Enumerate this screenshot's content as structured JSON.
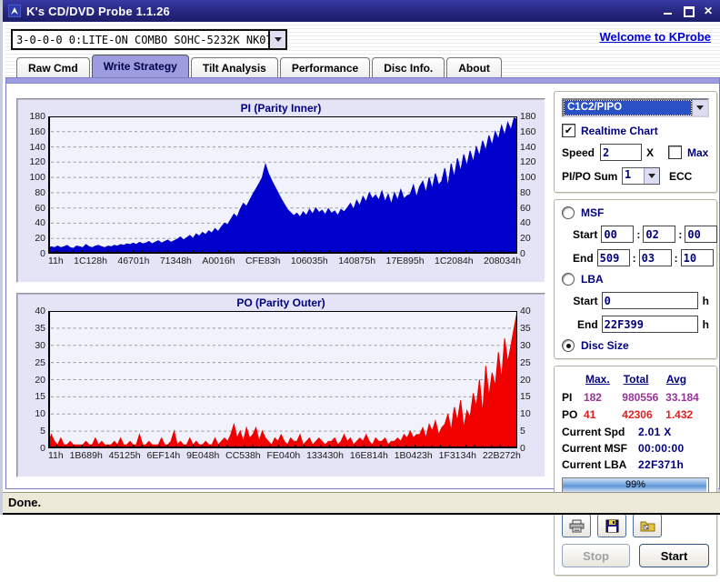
{
  "window": {
    "title": "K's CD/DVD Probe 1.1.26",
    "status": "Done."
  },
  "toolbar": {
    "device": "3-0-0-0 0:LITE-ON COMBO SOHC-5232K NK07",
    "welcome_link": "Welcome to KProbe"
  },
  "tabs": [
    {
      "label": "Raw Cmd",
      "active": false
    },
    {
      "label": "Write Strategy",
      "active": true
    },
    {
      "label": "Tilt Analysis",
      "active": false
    },
    {
      "label": "Performance",
      "active": false
    },
    {
      "label": "Disc Info.",
      "active": false
    },
    {
      "label": "About",
      "active": false
    }
  ],
  "controls": {
    "mode_select": "C1C2/PIPO",
    "realtime_chart": "Realtime Chart",
    "speed_label": "Speed",
    "speed_value": "2",
    "speed_unit": "X",
    "max_label": "Max",
    "pipo_sum_label": "PI/PO Sum",
    "pipo_sum_value": "1",
    "ecc_label": "ECC",
    "msf_label": "MSF",
    "start_label": "Start",
    "end_label": "End",
    "colon": ":",
    "msf_start": [
      "00",
      "02",
      "00"
    ],
    "msf_end": [
      "509",
      "03",
      "10"
    ],
    "lba_label": "LBA",
    "lba_start": "0",
    "lba_end": "22F399",
    "hex_unit": "h",
    "disc_size_label": "Disc Size"
  },
  "stats": {
    "headers": [
      "Max.",
      "Total",
      "Avg"
    ],
    "rows": [
      {
        "label": "PI",
        "max": "182",
        "total": "980556",
        "avg": "33.184",
        "color": "#993399"
      },
      {
        "label": "PO",
        "max": "41",
        "total": "42306",
        "avg": "1.432",
        "color": "#dd2222"
      }
    ],
    "current": [
      {
        "label": "Current Spd",
        "value": "2.01  X"
      },
      {
        "label": "Current MSF",
        "value": "00:00:00"
      },
      {
        "label": "Current LBA",
        "value": "22F371h"
      }
    ],
    "progress_pct": 99,
    "progress_text": "99%"
  },
  "buttons": {
    "stop": "Stop",
    "start": "Start"
  },
  "colors": {
    "pi": "#0000cc",
    "po": "#f20000",
    "accent_tab": "#9c9cde",
    "titlebar": "#26267e"
  },
  "chart_data": [
    {
      "type": "area",
      "title": "PI (Parity Inner)",
      "color": "#0000cc",
      "ylim": [
        0,
        180
      ],
      "ytick": 20,
      "grid": true,
      "x_labels": [
        "11h",
        "1C128h",
        "46701h",
        "71348h",
        "A0016h",
        "CFE83h",
        "106035h",
        "140875h",
        "17E895h",
        "1C2084h",
        "208034h"
      ],
      "values": [
        8,
        9,
        8,
        10,
        8,
        9,
        11,
        8,
        7,
        10,
        9,
        8,
        12,
        9,
        8,
        10,
        11,
        9,
        8,
        10,
        9,
        11,
        10,
        12,
        11,
        13,
        12,
        14,
        12,
        15,
        13,
        14,
        16,
        13,
        15,
        17,
        14,
        16,
        18,
        15,
        17,
        19,
        22,
        18,
        21,
        24,
        20,
        26,
        23,
        28,
        25,
        30,
        27,
        33,
        29,
        35,
        40,
        38,
        45,
        52,
        48,
        58,
        66,
        62,
        70,
        78,
        85,
        92,
        100,
        117,
        105,
        96,
        88,
        80,
        72,
        65,
        58,
        54,
        50,
        53,
        48,
        55,
        50,
        58,
        52,
        60,
        54,
        57,
        51,
        59,
        53,
        56,
        50,
        58,
        55,
        60,
        66,
        58,
        70,
        63,
        75,
        68,
        80,
        72,
        77,
        70,
        82,
        68,
        78,
        65,
        80,
        70,
        84,
        72,
        76,
        78,
        90,
        74,
        88,
        95,
        80,
        100,
        85,
        105,
        90,
        95,
        112,
        88,
        118,
        100,
        125,
        108,
        130,
        115,
        135,
        120,
        140,
        128,
        148,
        135,
        155,
        142,
        160,
        150,
        168,
        155,
        172,
        162,
        178,
        176
      ]
    },
    {
      "type": "area",
      "title": "PO (Parity Outer)",
      "color": "#f20000",
      "ylim": [
        0,
        40
      ],
      "ytick": 5,
      "grid": true,
      "x_labels": [
        "11h",
        "1B689h",
        "45125h",
        "6EF14h",
        "9E048h",
        "CC538h",
        "FE040h",
        "133430h",
        "16E814h",
        "1B0423h",
        "1F3134h",
        "22B272h"
      ],
      "values": [
        1,
        4,
        2,
        1,
        3,
        1,
        1,
        2,
        1,
        1,
        1,
        1,
        2,
        1,
        1,
        3,
        1,
        2,
        1,
        1,
        1,
        2,
        1,
        3,
        1,
        1,
        2,
        1,
        1,
        4,
        1,
        1,
        2,
        1,
        1,
        1,
        3,
        1,
        1,
        2,
        5,
        1,
        2,
        1,
        1,
        3,
        1,
        2,
        1,
        1,
        2,
        1,
        1,
        3,
        1,
        2,
        3,
        2,
        4,
        7,
        3,
        5,
        2,
        6,
        3,
        4,
        6,
        2,
        5,
        3,
        2,
        1,
        3,
        2,
        4,
        2,
        1,
        3,
        2,
        2,
        4,
        1,
        2,
        3,
        1,
        2,
        3,
        2,
        1,
        2,
        2,
        3,
        1,
        2,
        4,
        2,
        3,
        1,
        2,
        3,
        2,
        4,
        2,
        1,
        3,
        2,
        2,
        3,
        1,
        2,
        2,
        3,
        2,
        4,
        3,
        5,
        3,
        4,
        4,
        6,
        3,
        7,
        5,
        8,
        4,
        6,
        7,
        10,
        5,
        12,
        8,
        14,
        6,
        11,
        9,
        16,
        12,
        20,
        10,
        24,
        15,
        22,
        18,
        28,
        20,
        32,
        25,
        30,
        35,
        40
      ]
    }
  ]
}
